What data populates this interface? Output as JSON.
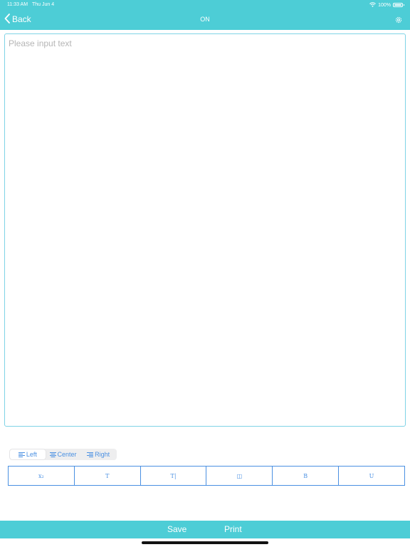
{
  "status": {
    "time": "11:33 AM",
    "date": "Thu Jun 4",
    "battery": "100%",
    "icons": [
      "wifi-icon",
      "battery-icon"
    ]
  },
  "nav": {
    "back_label": "Back",
    "title": "ON",
    "settings_icon": "gear-icon"
  },
  "editor": {
    "placeholder": "Please input text",
    "value": ""
  },
  "alignment": {
    "selected": "Left",
    "options": [
      {
        "label": "Left",
        "icon": "align-left-icon"
      },
      {
        "label": "Center",
        "icon": "align-center-icon"
      },
      {
        "label": "Right",
        "icon": "align-right-icon"
      }
    ]
  },
  "format": {
    "items": [
      {
        "name": "subscript",
        "glyph": "x₂"
      },
      {
        "name": "text-size",
        "glyph": "T"
      },
      {
        "name": "text-height",
        "glyph": "T|"
      },
      {
        "name": "columns",
        "glyph": "◫"
      },
      {
        "name": "bold",
        "glyph": "B"
      },
      {
        "name": "underline",
        "glyph": "U"
      }
    ]
  },
  "bottom": {
    "save_label": "Save",
    "print_label": "Print"
  },
  "colors": {
    "bar": "#4dcdd6",
    "accent": "#4a90e2",
    "border": "#7fd3e6",
    "placeholder": "#b5b5b5"
  }
}
